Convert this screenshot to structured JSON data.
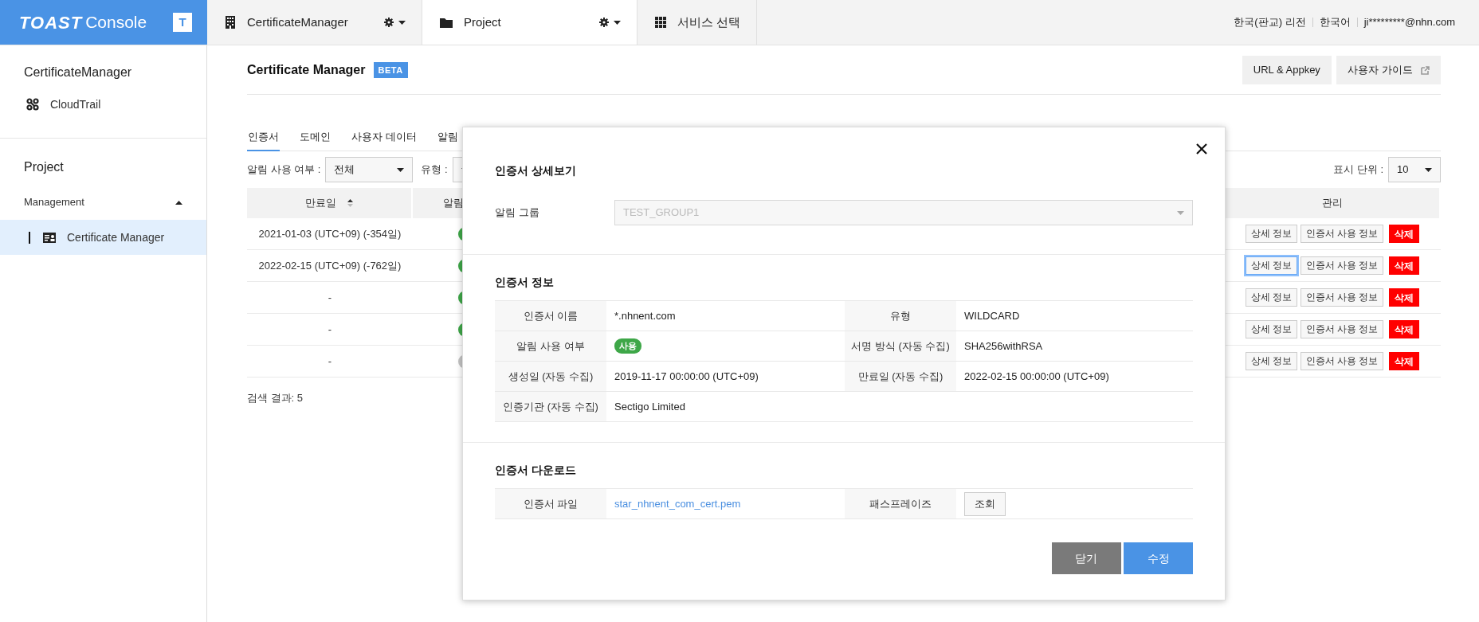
{
  "topbar": {
    "logo": "TOAST",
    "logo_suffix": "Console",
    "logo_badge": "T",
    "tabs": [
      {
        "label": "CertificateManager",
        "settings": true,
        "selected": false
      },
      {
        "label": "Project",
        "settings": true,
        "selected": true
      },
      {
        "label": "서비스 선택",
        "settings": false,
        "selected": false
      }
    ],
    "links": [
      "한국(판교) 리전",
      "한국어",
      "ji*********@nhn.com"
    ]
  },
  "sidebar": {
    "service_title": "CertificateManager",
    "service_items": [
      {
        "label": "CloudTrail",
        "selected": false
      }
    ],
    "project_title": "Project",
    "groups": [
      {
        "label": "Management",
        "expanded": true,
        "children": [
          {
            "label": "Certificate Manager",
            "selected": true
          }
        ]
      }
    ]
  },
  "page": {
    "title": "Certificate Manager",
    "badge": "BETA",
    "actions": [
      {
        "label": "URL & Appkey",
        "external": false
      },
      {
        "label": "사용자 가이드",
        "external": true
      }
    ],
    "tabs": [
      {
        "label": "인증서",
        "selected": true
      },
      {
        "label": "도메인",
        "selected": false
      },
      {
        "label": "사용자 데이터",
        "selected": false
      },
      {
        "label": "알림",
        "selected": false
      }
    ],
    "filters": [
      {
        "label": "알림 사용 여부 :",
        "value": "전체"
      },
      {
        "label": "유형 :"
      }
    ],
    "page_size": {
      "label": "표시 단위 :",
      "value": "10"
    },
    "table": {
      "columns": [
        "만료일",
        "알림",
        "관리"
      ],
      "rows": [
        {
          "expiry": "2021-01-03 (UTC+09) (-354일)",
          "color": "#3ea748",
          "actions": [
            "상세 정보",
            "인증서 사용 정보",
            "삭제"
          ],
          "focused": false
        },
        {
          "expiry": "2022-02-15 (UTC+09) (-762일)",
          "color": "#3ea748",
          "actions": [
            "상세 정보",
            "인증서 사용 정보",
            "삭제"
          ],
          "focused": true
        },
        {
          "expiry": "-",
          "color": "#3ea748",
          "actions": [
            "상세 정보",
            "인증서 사용 정보",
            "삭제"
          ],
          "focused": false
        },
        {
          "expiry": "-",
          "color": "#3ea748",
          "actions": [
            "상세 정보",
            "인증서 사용 정보",
            "삭제"
          ],
          "focused": false
        },
        {
          "expiry": "-",
          "color": "#c4c4c4",
          "actions": [
            "상세 정보",
            "인증서 사용 정보",
            "삭제"
          ],
          "focused": false
        }
      ]
    },
    "result": "검색 결과: 5"
  },
  "modal": {
    "title": "인증서 상세보기",
    "group": {
      "label": "알림 그룹",
      "value": "TEST_GROUP1",
      "disabled": true
    },
    "info": {
      "title": "인증서 정보",
      "rows": [
        [
          {
            "label": "인증서 이름",
            "value": "*.nhnent.com",
            "kind": "text"
          },
          {
            "label": "유형",
            "value": "WILDCARD",
            "kind": "text"
          }
        ],
        [
          {
            "label": "알림 사용 여부",
            "value": "사용",
            "kind": "badge"
          },
          {
            "label": "서명 방식 (자동 수집)",
            "value": "SHA256withRSA",
            "kind": "text"
          }
        ],
        [
          {
            "label": "생성일 (자동 수집)",
            "value": "2019-11-17 00:00:00 (UTC+09)",
            "kind": "text"
          },
          {
            "label": "만료일 (자동 수집)",
            "value": "2022-02-15 00:00:00 (UTC+09)",
            "kind": "text"
          }
        ],
        [
          {
            "label": "인증기관 (자동 수집)",
            "value": "Sectigo Limited",
            "kind": "text"
          }
        ]
      ]
    },
    "download": {
      "title": "인증서 다운로드",
      "rows": [
        [
          {
            "label": "인증서 파일",
            "value": "star_nhnent_com_cert.pem",
            "kind": "link"
          },
          {
            "label": "패스프레이즈",
            "value": "조회",
            "kind": "button"
          }
        ]
      ]
    },
    "buttons": [
      {
        "label": "닫기",
        "kind": "secondary"
      },
      {
        "label": "수정",
        "kind": "primary"
      }
    ]
  }
}
